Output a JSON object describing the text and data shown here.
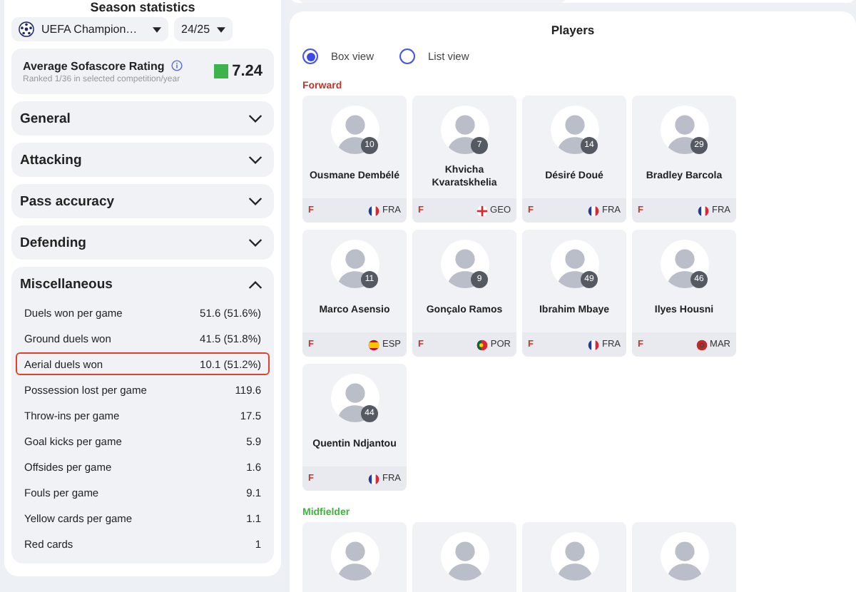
{
  "season_statistics": {
    "title": "Season statistics",
    "competition": "UEFA Champion…",
    "season": "24/25",
    "rating": {
      "label": "Average Sofascore Rating",
      "sublabel": "Ranked 1/36 in selected competition/year",
      "value": "7.24"
    },
    "sections": [
      {
        "title": "General",
        "expanded": false
      },
      {
        "title": "Attacking",
        "expanded": false
      },
      {
        "title": "Pass accuracy",
        "expanded": false
      },
      {
        "title": "Defending",
        "expanded": false
      },
      {
        "title": "Miscellaneous",
        "expanded": true,
        "rows": [
          {
            "label": "Duels won per game",
            "value": "51.6 (51.6%)",
            "highlighted": false
          },
          {
            "label": "Ground duels won",
            "value": "41.5 (51.8%)",
            "highlighted": false
          },
          {
            "label": "Aerial duels won",
            "value": "10.1 (51.2%)",
            "highlighted": true
          },
          {
            "label": "Possession lost per game",
            "value": "119.6",
            "highlighted": false
          },
          {
            "label": "Throw-ins per game",
            "value": "17.5",
            "highlighted": false
          },
          {
            "label": "Goal kicks per game",
            "value": "5.9",
            "highlighted": false
          },
          {
            "label": "Offsides per game",
            "value": "1.6",
            "highlighted": false
          },
          {
            "label": "Fouls per game",
            "value": "9.1",
            "highlighted": false
          },
          {
            "label": "Yellow cards per game",
            "value": "1.1",
            "highlighted": false
          },
          {
            "label": "Red cards",
            "value": "1",
            "highlighted": false
          }
        ]
      }
    ]
  },
  "players": {
    "title": "Players",
    "views": [
      {
        "label": "Box view",
        "selected": true
      },
      {
        "label": "List view",
        "selected": false
      }
    ],
    "groups": [
      {
        "title": "Forward",
        "color": "#c7362b",
        "players": [
          {
            "kind": "fra",
            "name": "Ousmane Dembélé",
            "number": "10",
            "position": "F",
            "country": "FRA"
          },
          {
            "kind": "geo",
            "name": "Khvicha Kvaratskhelia",
            "number": "7",
            "position": "F",
            "country": "GEO"
          },
          {
            "kind": "fra",
            "name": "Désiré Doué",
            "number": "14",
            "position": "F",
            "country": "FRA"
          },
          {
            "kind": "fra",
            "name": "Bradley Barcola",
            "number": "29",
            "position": "F",
            "country": "FRA"
          },
          {
            "kind": "esp",
            "name": "Marco Asensio",
            "number": "11",
            "position": "F",
            "country": "ESP"
          },
          {
            "kind": "por",
            "name": "Gonçalo Ramos",
            "number": "9",
            "position": "F",
            "country": "POR"
          },
          {
            "kind": "fra",
            "name": "Ibrahim Mbaye",
            "number": "49",
            "position": "F",
            "country": "FRA"
          },
          {
            "kind": "mar",
            "name": "Ilyes Housni",
            "number": "46",
            "position": "F",
            "country": "MAR"
          },
          {
            "kind": "fra",
            "name": "Quentin Ndjantou",
            "number": "44",
            "position": "F",
            "country": "FRA"
          }
        ]
      },
      {
        "title": "Midfielder",
        "color": "#3fb53f",
        "cut_off_cards": [
          {
            "kind": "cut"
          },
          {
            "kind": "cut"
          },
          {
            "kind": "cut"
          },
          {
            "kind": "cut"
          }
        ]
      }
    ]
  }
}
